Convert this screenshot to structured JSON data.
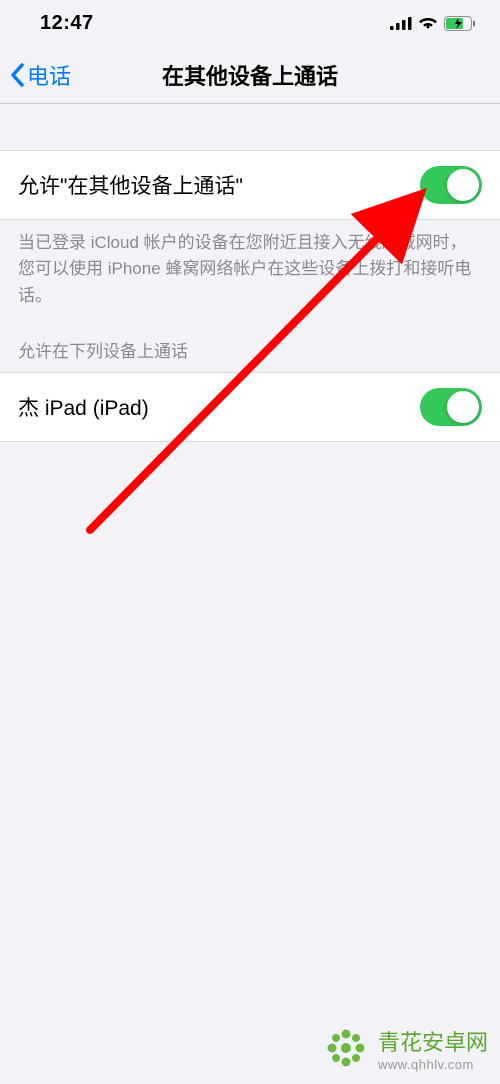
{
  "status_bar": {
    "time": "12:47"
  },
  "nav": {
    "back_label": "电话",
    "title": "在其他设备上通话"
  },
  "main_setting": {
    "label": "允许\"在其他设备上通话\"",
    "enabled": true
  },
  "footer_text": "当已登录 iCloud 帐户的设备在您附近且接入无线局域网时，您可以使用 iPhone 蜂窝网络帐户在这些设备上拨打和接听电话。",
  "devices_section": {
    "header": "允许在下列设备上通话",
    "items": [
      {
        "label": "杰 iPad (iPad)",
        "enabled": true
      }
    ]
  },
  "watermark": {
    "title": "青花安卓网",
    "url": "www.qhhlv.com"
  },
  "colors": {
    "toggle_on": "#34c759",
    "link": "#007aff",
    "arrow": "#ff0000",
    "brand": "#5ba82e"
  }
}
